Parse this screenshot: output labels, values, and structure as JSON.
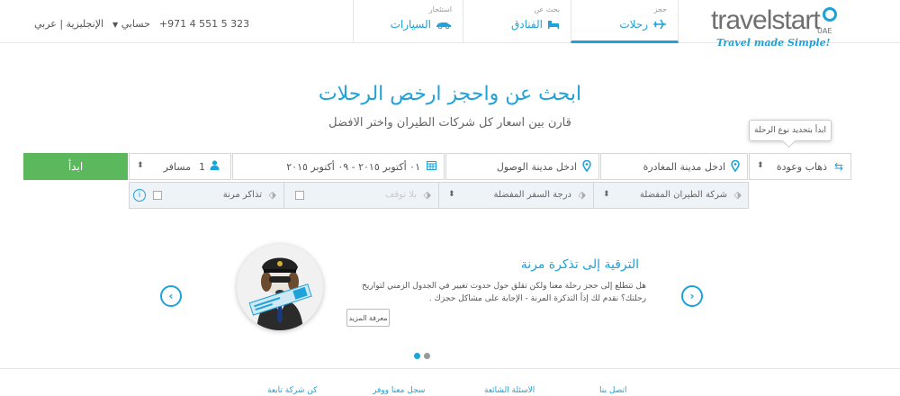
{
  "brand": {
    "name": "travelstart",
    "region": "UAE",
    "tagline": "Travel made Simple!",
    "accent_color": "#1ea2d7",
    "button_color": "#5cb85c"
  },
  "nav_tabs": [
    {
      "small": "حجز",
      "label": "رحلات",
      "icon": "airplane-icon",
      "active": true
    },
    {
      "small": "بحث عن",
      "label": "الفنادق",
      "icon": "bed-icon",
      "active": false
    },
    {
      "small": "استئجار",
      "label": "السيارات",
      "icon": "car-icon",
      "active": false
    }
  ],
  "topbar": {
    "phone": "+971 4 551 5 323",
    "account": "حسابي",
    "languages": "الإنجليزية | عربي"
  },
  "hero": {
    "title": "ابحث عن واحجز ارخص الرحلات",
    "subtitle": "قارن بين اسعار كل شركات الطيران واختر الافضل"
  },
  "search": {
    "tooltip": "ابدأ بتحديد نوع الرحلة",
    "trip_type": "ذهاب وعودة",
    "origin_placeholder": "ادخل مدينة المغادرة",
    "destination_placeholder": "ادخل مدينة الوصول",
    "dates": "٠١ أكتوبر ٢٠١٥ - ٠٩ أكتوبر ٢٠١٥",
    "passenger_count": "1",
    "passenger_label": "مسافر",
    "search_button": "ابدأ"
  },
  "options": {
    "airline": "شركة الطيران المفضلة",
    "cabin_class": "درجة السفر المفضلة",
    "stops": "بلا توقف",
    "flexible": "تذاكر مرنة",
    "info": "i"
  },
  "promo": {
    "title": "الترقية إلى تذكرة مرنة",
    "text": "هل تتطلع إلى حجز رحلة معنا ولكن تقلق حول حدوث تغيير في الجدول الزمني لتواريخ رحلتك؟ نقدم لك إذاً التذكرة المرنة - الإجابة على مشاكل حجزك .",
    "button": "معرفة المزيد",
    "slides": 2,
    "active_slide": 1
  },
  "footer": {
    "links": [
      "اتصل بنا",
      "الاسئلة الشائعة",
      "سجل معنا ووفر",
      "كن شركة تابعة"
    ]
  }
}
